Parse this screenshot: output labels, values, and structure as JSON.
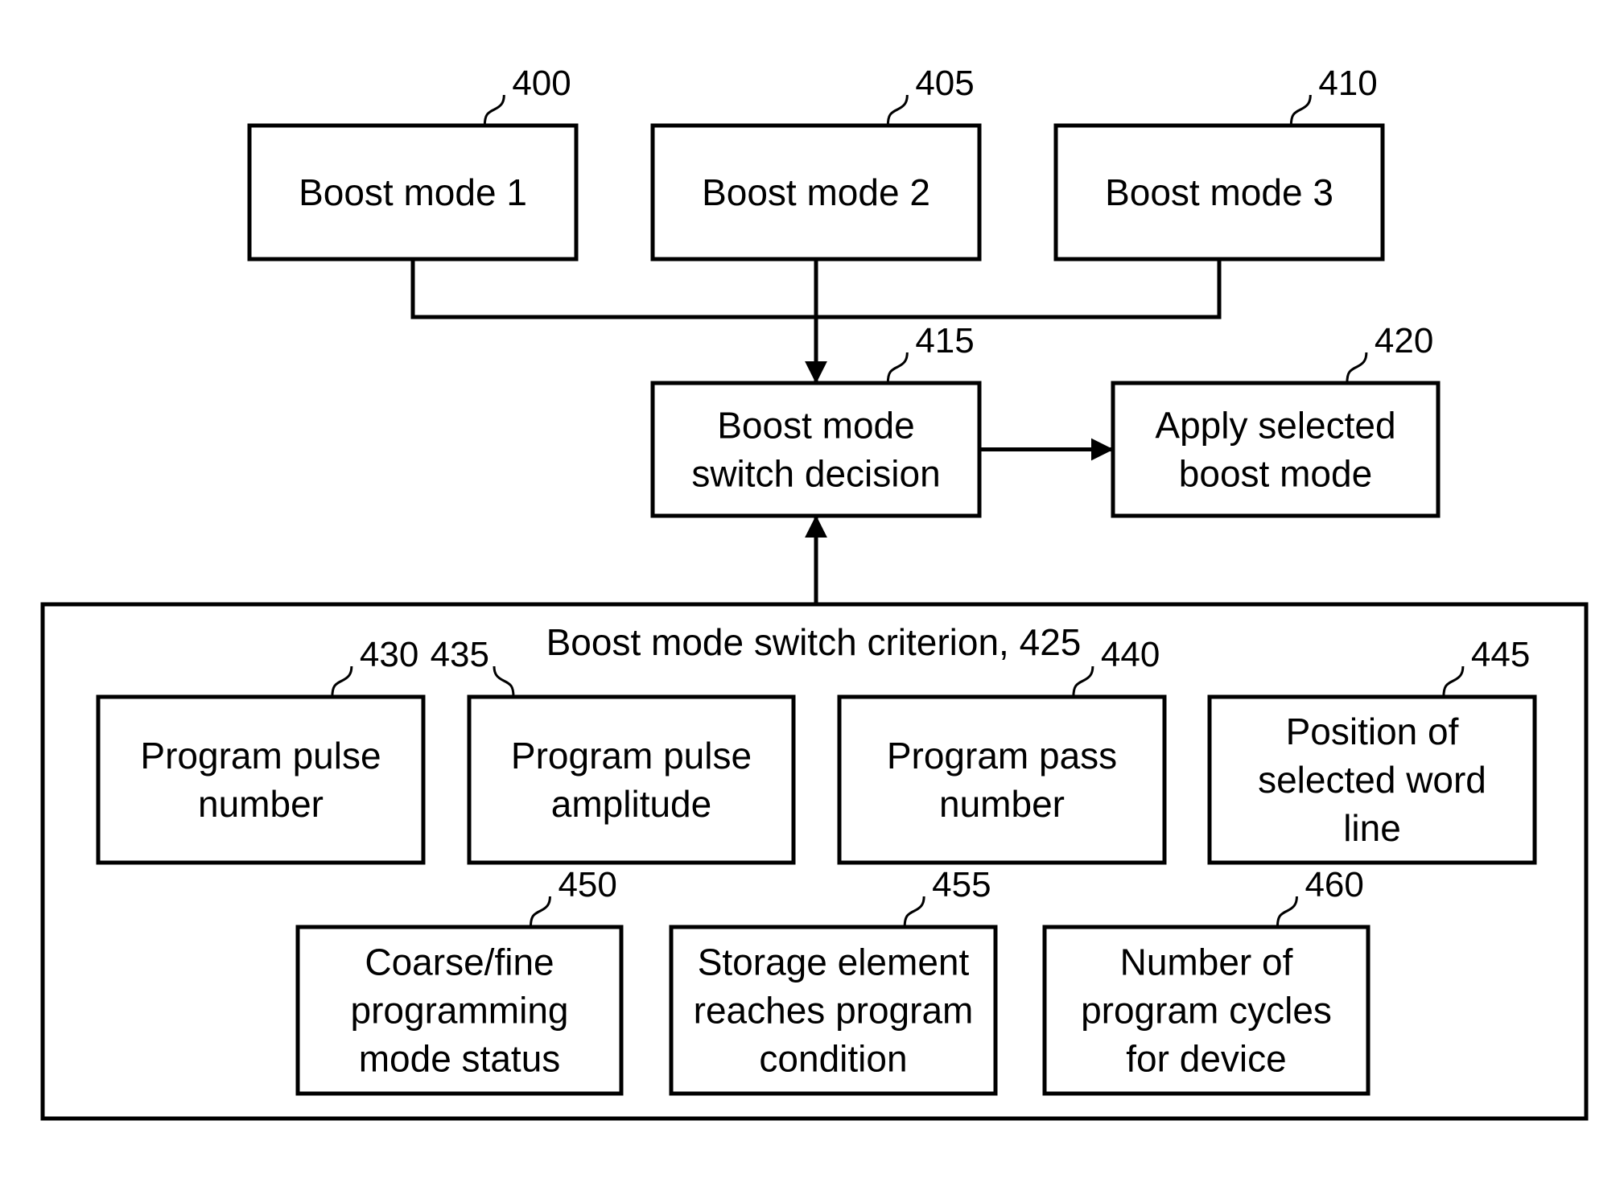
{
  "figure": {
    "nodes": [
      {
        "id": "400",
        "ref": "400",
        "lines": [
          "Boost mode 1"
        ]
      },
      {
        "id": "405",
        "ref": "405",
        "lines": [
          "Boost mode 2"
        ]
      },
      {
        "id": "410",
        "ref": "410",
        "lines": [
          "Boost mode 3"
        ]
      },
      {
        "id": "415",
        "ref": "415",
        "lines": [
          "Boost mode",
          "switch decision"
        ]
      },
      {
        "id": "420",
        "ref": "420",
        "lines": [
          "Apply selected",
          "boost mode"
        ]
      },
      {
        "id": "430",
        "ref": "430",
        "lines": [
          "Program pulse",
          "number"
        ]
      },
      {
        "id": "435",
        "ref": "435",
        "lines": [
          "Program pulse",
          "amplitude"
        ]
      },
      {
        "id": "440",
        "ref": "440",
        "lines": [
          "Program pass",
          "number"
        ]
      },
      {
        "id": "445",
        "ref": "445",
        "lines": [
          "Position of",
          "selected word",
          "line"
        ]
      },
      {
        "id": "450",
        "ref": "450",
        "lines": [
          "Coarse/fine",
          "programming",
          "mode status"
        ]
      },
      {
        "id": "455",
        "ref": "455",
        "lines": [
          "Storage element",
          "reaches program",
          "condition"
        ]
      },
      {
        "id": "460",
        "ref": "460",
        "lines": [
          "Number of",
          "program cycles",
          "for device"
        ]
      }
    ],
    "container": {
      "id": "425",
      "label": "Boost mode switch criterion, 425"
    },
    "edges": [
      {
        "from": "400",
        "to": "415"
      },
      {
        "from": "405",
        "to": "415"
      },
      {
        "from": "410",
        "to": "415"
      },
      {
        "from": "415",
        "to": "420"
      },
      {
        "from": "425",
        "to": "415"
      }
    ]
  }
}
